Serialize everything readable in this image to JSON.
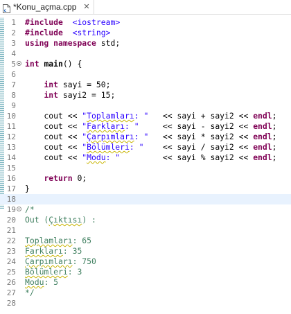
{
  "tab": {
    "title": "*Konu_açma.cpp",
    "close_label": "✕",
    "icon": "cpp-file-icon"
  },
  "colors": {
    "keyword": "#7f0055",
    "string": "#2a00ff",
    "comment": "#3f7f5f",
    "line_number": "#787878",
    "current_line": "#e8f2fe",
    "ruler": "#7fb7c2"
  },
  "editor": {
    "lines": [
      {
        "n": "1",
        "segs": [
          [
            "kw",
            "#include"
          ],
          [
            "",
            "  "
          ],
          [
            "str",
            "<iostream>"
          ]
        ]
      },
      {
        "n": "2",
        "segs": [
          [
            "kw",
            "#include"
          ],
          [
            "",
            "  "
          ],
          [
            "str",
            "<string>"
          ]
        ]
      },
      {
        "n": "3",
        "segs": [
          [
            "kw",
            "using"
          ],
          [
            "",
            " "
          ],
          [
            "kw",
            "namespace"
          ],
          [
            "",
            " std;"
          ]
        ]
      },
      {
        "n": "4",
        "segs": []
      },
      {
        "n": "5",
        "fold": true,
        "segs": [
          [
            "kw",
            "int"
          ],
          [
            "",
            " "
          ],
          [
            "bold",
            "main"
          ],
          [
            "",
            "() {"
          ]
        ]
      },
      {
        "n": "6",
        "segs": []
      },
      {
        "n": "7",
        "segs": [
          [
            "",
            "    "
          ],
          [
            "kw",
            "int"
          ],
          [
            "",
            " sayi = 50;"
          ]
        ]
      },
      {
        "n": "8",
        "segs": [
          [
            "",
            "    "
          ],
          [
            "kw",
            "int"
          ],
          [
            "",
            " sayi2 = 15;"
          ]
        ]
      },
      {
        "n": "9",
        "segs": []
      },
      {
        "n": "10",
        "segs": [
          [
            "",
            "    cout << "
          ],
          [
            "str",
            "\"Toplamları: \""
          ],
          [
            "",
            "   << sayi + sayi2 << "
          ],
          [
            "kw",
            "endl"
          ],
          [
            "",
            ";"
          ]
        ]
      },
      {
        "n": "11",
        "segs": [
          [
            "",
            "    cout << "
          ],
          [
            "str",
            "\"Farkları: \""
          ],
          [
            "",
            "     << sayi - sayi2 << "
          ],
          [
            "kw",
            "endl"
          ],
          [
            "",
            ";"
          ]
        ]
      },
      {
        "n": "12",
        "segs": [
          [
            "",
            "    cout << "
          ],
          [
            "str",
            "\"Çarpımları: \""
          ],
          [
            "",
            "   << sayi * sayi2 << "
          ],
          [
            "kw",
            "endl"
          ],
          [
            "",
            ";"
          ]
        ]
      },
      {
        "n": "13",
        "segs": [
          [
            "",
            "    cout << "
          ],
          [
            "str",
            "\"Bölümleri: \""
          ],
          [
            "",
            "    << sayi / sayi2 << "
          ],
          [
            "kw",
            "endl"
          ],
          [
            "",
            ";"
          ]
        ]
      },
      {
        "n": "14",
        "segs": [
          [
            "",
            "    cout << "
          ],
          [
            "str",
            "\"Modu: \""
          ],
          [
            "",
            "         << sayi % sayi2 << "
          ],
          [
            "kw",
            "endl"
          ],
          [
            "",
            ";"
          ]
        ]
      },
      {
        "n": "15",
        "segs": []
      },
      {
        "n": "16",
        "segs": [
          [
            "",
            "    "
          ],
          [
            "kw",
            "return"
          ],
          [
            "",
            " 0;"
          ]
        ]
      },
      {
        "n": "17",
        "segs": [
          [
            "",
            "}"
          ]
        ]
      },
      {
        "n": "18",
        "current": true,
        "segs": []
      },
      {
        "n": "19",
        "fold": true,
        "segs": [
          [
            "cm",
            "/*"
          ]
        ]
      },
      {
        "n": "20",
        "segs": [
          [
            "cm",
            "Out (Çıktısı) :"
          ]
        ]
      },
      {
        "n": "21",
        "segs": []
      },
      {
        "n": "22",
        "segs": [
          [
            "cm",
            "Toplamları: 65"
          ]
        ]
      },
      {
        "n": "23",
        "segs": [
          [
            "cm",
            "Farkları: 35"
          ]
        ]
      },
      {
        "n": "24",
        "segs": [
          [
            "cm",
            "Çarpımları: 750"
          ]
        ]
      },
      {
        "n": "25",
        "segs": [
          [
            "cm",
            "Bölümleri: 3"
          ]
        ]
      },
      {
        "n": "26",
        "segs": [
          [
            "cm",
            "Modu: 5"
          ]
        ]
      },
      {
        "n": "27",
        "segs": [
          [
            "cm",
            "*/"
          ]
        ]
      },
      {
        "n": "28",
        "segs": []
      }
    ]
  }
}
